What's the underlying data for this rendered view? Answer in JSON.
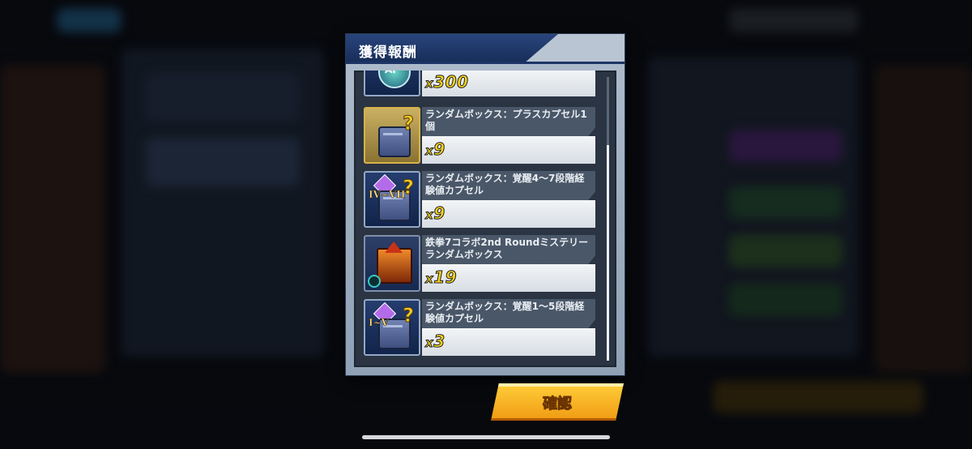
{
  "dialog": {
    "title": "獲得報酬",
    "confirm_label": "確認"
  },
  "rewards": [
    {
      "name": "",
      "quantity_prefix": "x",
      "quantity": "300",
      "icon": "ap-icon",
      "frame": "blue",
      "icon_text": "AP"
    },
    {
      "name": "ランダムボックス：プラスカプセル1個",
      "quantity_prefix": "x",
      "quantity": "9",
      "icon": "plus-capsule-box-icon",
      "frame": "gold"
    },
    {
      "name": "ランダムボックス：覚醒4〜7段階経験値カプセル",
      "quantity_prefix": "x",
      "quantity": "9",
      "icon": "awakening-capsule-box-icon",
      "frame": "blue",
      "icon_text": "IV~VII"
    },
    {
      "name": "鉄拳7コラボ2nd Roundミステリーランダムボックス",
      "quantity_prefix": "x",
      "quantity": "19",
      "icon": "mystery-crate-icon",
      "frame": "blue"
    },
    {
      "name": "ランダムボックス：覚醒1〜5段階経験値カプセル",
      "quantity_prefix": "x",
      "quantity": "3",
      "icon": "awakening-capsule-box-icon",
      "frame": "blue",
      "icon_text": "I~V"
    }
  ],
  "colors": {
    "accent": "#f7d31b",
    "title_plate": "#1f3a6c",
    "button": "#f5b21f"
  }
}
